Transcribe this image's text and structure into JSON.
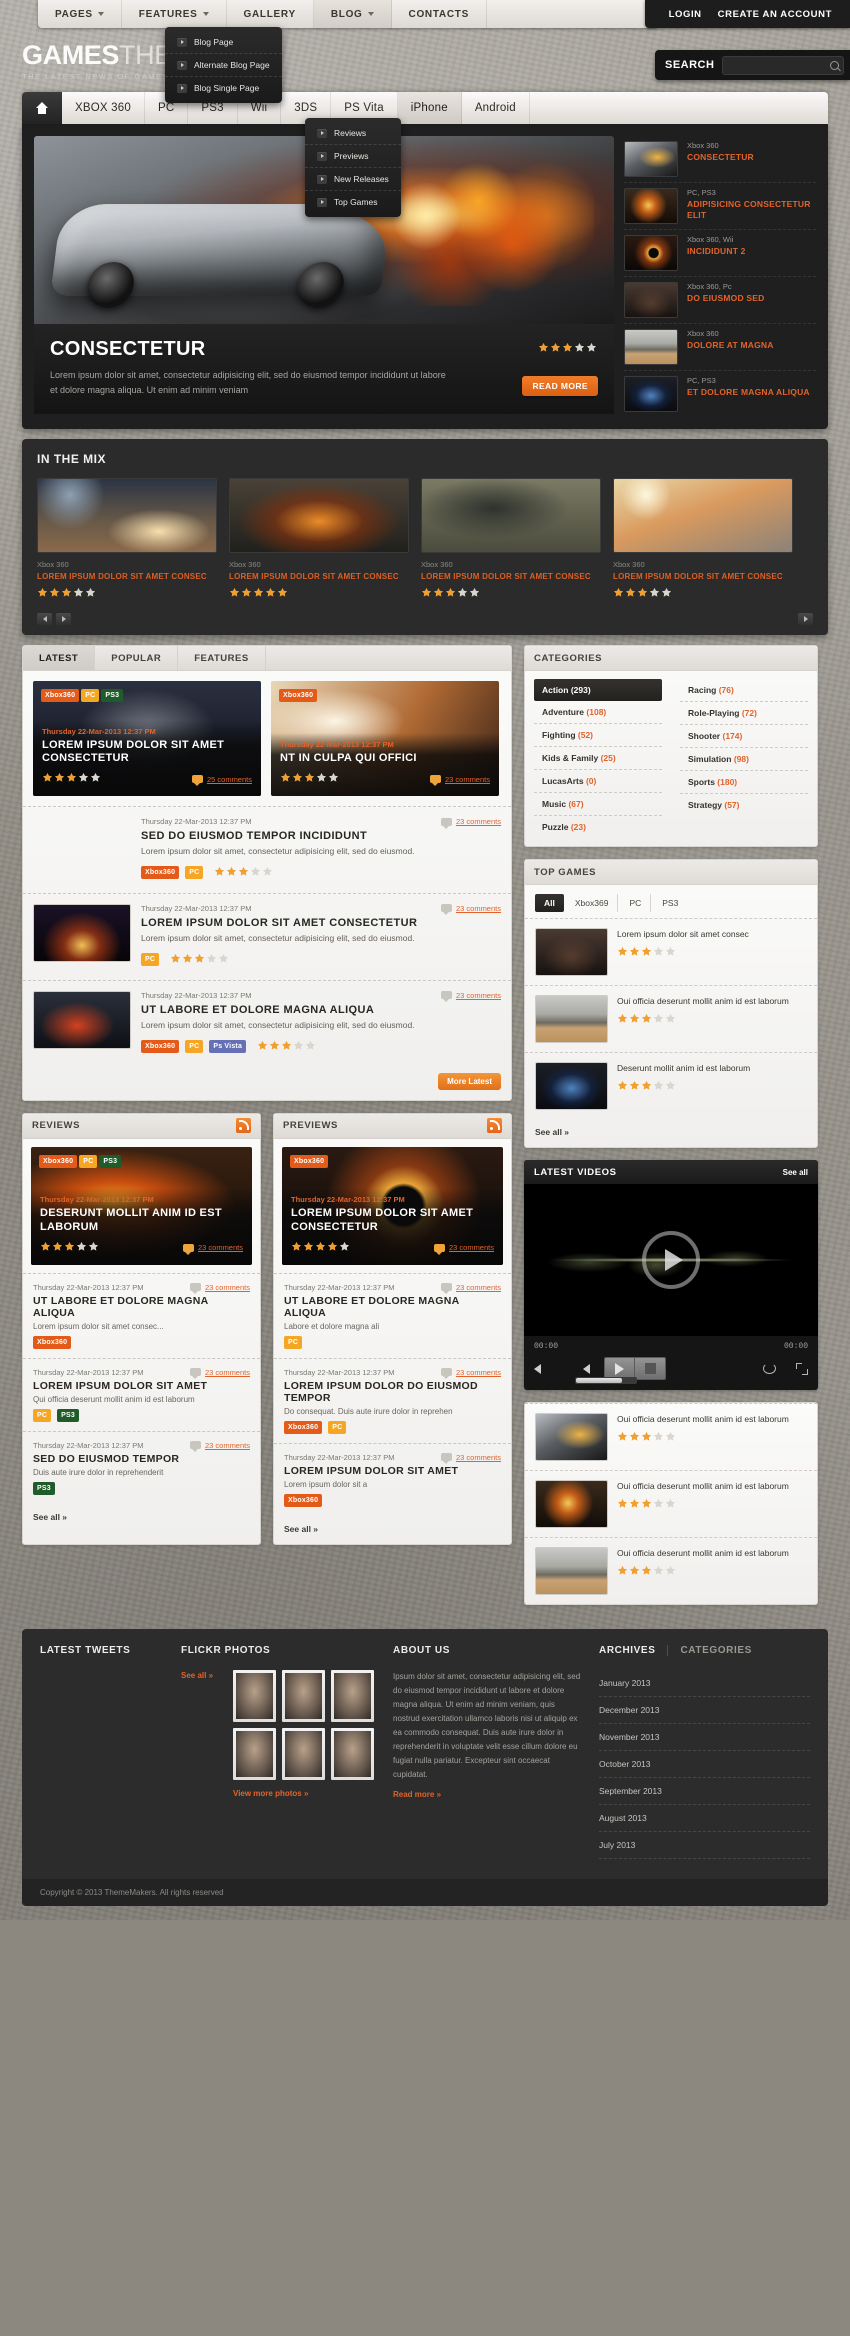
{
  "topnav": {
    "items": [
      {
        "label": "PAGES",
        "caret": true,
        "active": false
      },
      {
        "label": "FEATURES",
        "caret": true,
        "active": false
      },
      {
        "label": "GALLERY",
        "caret": false,
        "active": false
      },
      {
        "label": "BLOG",
        "caret": true,
        "active": true
      },
      {
        "label": "CONTACTS",
        "caret": false,
        "active": false
      }
    ],
    "auth": {
      "login": "LOGIN",
      "create": "CREATE AN ACCOUNT"
    }
  },
  "blog_dropdown": {
    "items": [
      "Blog Page",
      "Alternate Blog Page",
      "Blog Single Page"
    ]
  },
  "platform_dropdown": {
    "items": [
      "Reviews",
      "Previews",
      "New Releases",
      "Top Games"
    ]
  },
  "header": {
    "logo_bold": "GAMES",
    "logo_light": "THEME",
    "tagline": "THE LATEST NEWS OF GAMES",
    "search_label": "SEARCH",
    "search_placeholder": "",
    "search_value": ""
  },
  "platnav": {
    "home_icon": "home-icon",
    "items": [
      {
        "label": "XBOX 360",
        "active": false
      },
      {
        "label": "PC",
        "active": false
      },
      {
        "label": "PS3",
        "active": false
      },
      {
        "label": "Wii",
        "active": false
      },
      {
        "label": "3DS",
        "active": false
      },
      {
        "label": "PS Vita",
        "active": false
      },
      {
        "label": "iPhone",
        "active": true
      },
      {
        "label": "Android",
        "active": false
      }
    ]
  },
  "slider": {
    "title": "CONSECTETUR",
    "excerpt": "Lorem ipsum dolor sit amet, consectetur adipisicing elit, sed do eiusmod tempor incididunt ut labore et dolore magna aliqua. Ut enim ad minim veniam",
    "rating": 3,
    "read_more": "READ MORE",
    "items": [
      {
        "platform": "Xbox 360",
        "title": "CONSECTETUR",
        "thumb": "car-race"
      },
      {
        "platform": "PC, PS3",
        "title": "ADIPISICING CONSECTETUR ELIT",
        "thumb": "explosion"
      },
      {
        "platform": "Xbox 360, Wii",
        "title": "INCIDIDUNT 2",
        "thumb": "eclipse"
      },
      {
        "platform": "Xbox 360, Pc",
        "title": "DO EIUSMOD SED",
        "thumb": "dark-forest"
      },
      {
        "platform": "Xbox 360",
        "title": "DOLORE AT MAGNA",
        "thumb": "tank"
      },
      {
        "platform": "PC, PS3",
        "title": "ET DOLORE MAGNA ALIQUA",
        "thumb": "blue-mech"
      }
    ]
  },
  "mix": {
    "heading": "IN THE MIX",
    "cards": [
      {
        "platform": "Xbox 360",
        "title": "LOREM IPSUM DOLOR SIT AMET CONSEC",
        "rating": 3,
        "art": "planet"
      },
      {
        "platform": "Xbox 360",
        "title": "LOREM IPSUM DOLOR SIT AMET CONSEC",
        "rating": 5,
        "art": "foundry"
      },
      {
        "platform": "Xbox 360",
        "title": "LOREM IPSUM DOLOR SIT AMET CONSEC",
        "rating": 3,
        "art": "mech"
      },
      {
        "platform": "Xbox 360",
        "title": "LOREM IPSUM DOLOR SIT AMET CONSEC",
        "rating": 3,
        "art": "desert"
      }
    ]
  },
  "main_tabs": [
    {
      "label": "LATEST",
      "active": true
    },
    {
      "label": "POPULAR",
      "active": false
    },
    {
      "label": "FEATURES",
      "active": false
    }
  ],
  "hero_posts": [
    {
      "badges": [
        "Xbox360",
        "PC",
        "PS3"
      ],
      "date": "Thursday 22-Mar-2013 12:37 PM",
      "title": "LOREM IPSUM DOLOR SIT AMET CONSECTETUR",
      "rating": 3,
      "comments": "25 comments",
      "art": "warrior"
    },
    {
      "badges": [
        "Xbox360"
      ],
      "date": "Thursday 22-Mar-2013 12:37 PM",
      "title": "NT IN CULPA QUI OFFICI",
      "rating": 3,
      "comments": "23 comments",
      "art": "biker"
    }
  ],
  "posts": [
    {
      "date": "Thursday 22-Mar-2013 12:37 PM",
      "comments": "23 comments",
      "title": "SED DO EIUSMOD TEMPOR INCIDIDUNT",
      "excerpt": "Lorem ipsum dolor sit amet, consectetur adipisicing elit, sed do eiusmod.",
      "badges": [
        "Xbox360",
        "PC"
      ],
      "rating": 3,
      "thumb": null
    },
    {
      "date": "Thursday 22-Mar-2013 12:37 PM",
      "comments": "23 comments",
      "title": "LOREM IPSUM DOLOR SIT AMET CONSECTETUR",
      "excerpt": "Lorem ipsum dolor sit amet, consectetur adipisicing elit, sed do eiusmod.",
      "badges": [
        "PC"
      ],
      "rating": 3,
      "thumb": "nebula"
    },
    {
      "date": "Thursday 22-Mar-2013 12:37 PM",
      "comments": "23 comments",
      "title": "UT LABORE ET DOLORE MAGNA ALIQUA",
      "excerpt": "Lorem ipsum dolor sit amet, consectetur adipisicing elit, sed do eiusmod.",
      "badges": [
        "Xbox360",
        "PC",
        "Ps Vista"
      ],
      "rating": 3,
      "thumb": "redcar"
    }
  ],
  "more_latest": "More Latest",
  "categories": {
    "heading": "CATEGORIES",
    "left": [
      {
        "name": "Action",
        "count": "(293)",
        "active": true
      },
      {
        "name": "Adventure",
        "count": "(108)",
        "active": false
      },
      {
        "name": "Fighting",
        "count": "(52)",
        "active": false
      },
      {
        "name": "Kids & Family",
        "count": "(25)",
        "active": false
      },
      {
        "name": "LucasArts",
        "count": "(0)",
        "active": false
      },
      {
        "name": "Music",
        "count": "(67)",
        "active": false
      },
      {
        "name": "Puzzle",
        "count": "(23)",
        "active": false
      }
    ],
    "right": [
      {
        "name": "Racing",
        "count": "(76)",
        "active": false
      },
      {
        "name": "Role-Playing",
        "count": "(72)",
        "active": false
      },
      {
        "name": "Shooter",
        "count": "(174)",
        "active": false
      },
      {
        "name": "Simulation",
        "count": "(98)",
        "active": false
      },
      {
        "name": "Sports",
        "count": "(180)",
        "active": false
      },
      {
        "name": "Strategy",
        "count": "(57)",
        "active": false
      }
    ]
  },
  "top_games": {
    "heading": "TOP GAMES",
    "filters": [
      {
        "label": "All",
        "active": true
      },
      {
        "label": "Xbox369",
        "active": false
      },
      {
        "label": "PC",
        "active": false
      },
      {
        "label": "PS3",
        "active": false
      }
    ],
    "items": [
      {
        "title": "Lorem ipsum dolor sit amet consec",
        "rating": 3,
        "art": "dark-forest"
      },
      {
        "title": "Oui officia deserunt mollit anim id est laborum",
        "rating": 3,
        "art": "tank"
      },
      {
        "title": "Deserunt mollit anim id est laborum",
        "rating": 3,
        "art": "blue-mech"
      }
    ],
    "see_all": "See all »"
  },
  "videos": {
    "heading": "LATEST VIDEOS",
    "see_all": "See all",
    "time_left": "00:00",
    "time_right": "00:00",
    "items": [
      {
        "title": "Oui officia deserunt mollit anim id est laborum",
        "rating": 3,
        "art": "car-race"
      },
      {
        "title": "Oui officia deserunt mollit anim id est laborum",
        "rating": 3,
        "art": "explosion"
      },
      {
        "title": "Oui officia deserunt mollit anim id est laborum",
        "rating": 3,
        "art": "tank"
      }
    ]
  },
  "reviews": {
    "heading": "REVIEWS",
    "hero": {
      "badges": [
        "Xbox360",
        "PC",
        "PS3"
      ],
      "date": "Thursday 22-Mar-2013 12:37 PM",
      "title": "DESERUNT MOLLIT ANIM ID EST LABORUM",
      "rating": 3,
      "comments": "23 comments",
      "art": "firefight"
    },
    "rows": [
      {
        "date": "Thursday 22-Mar-2013 12:37 PM",
        "comments": "23 comments",
        "title": "UT LABORE ET DOLORE MAGNA ALIQUA",
        "excerpt": "Lorem ipsum dolor sit amet consec...",
        "badges": [
          "Xbox360"
        ]
      },
      {
        "date": "Thursday 22-Mar-2013 12:37 PM",
        "comments": "23 comments",
        "title": "LOREM IPSUM DOLOR SIT AMET",
        "excerpt": "Qui officia deserunt mollit anim id est laborum",
        "badges": [
          "PC",
          "PS3"
        ]
      },
      {
        "date": "Thursday 22-Mar-2013 12:37 PM",
        "comments": "23 comments",
        "title": "SED DO EIUSMOD TEMPOR",
        "excerpt": "Duis aute irure dolor in reprehenderit",
        "badges": [
          "PS3"
        ]
      }
    ],
    "see_all": "See all »"
  },
  "previews": {
    "heading": "PREVIEWS",
    "hero": {
      "badges": [
        "Xbox360"
      ],
      "date": "Thursday 22-Mar-2013 12:37 PM",
      "title": "LOREM IPSUM DOLOR SIT AMET CONSECTETUR",
      "rating": 4,
      "comments": "23 comments",
      "art": "eclipse"
    },
    "rows": [
      {
        "date": "Thursday 22-Mar-2013 12:37 PM",
        "comments": "23 comments",
        "title": "UT LABORE ET DOLORE MAGNA ALIQUA",
        "excerpt": "Labore et dolore magna ali",
        "badges": [
          "PC"
        ]
      },
      {
        "date": "Thursday 22-Mar-2013 12:37 PM",
        "comments": "23 comments",
        "title": "LOREM IPSUM DOLOR DO EIUSMOD TEMPOR",
        "excerpt": "Do consequat. Duis aute irure dolor in reprehen",
        "badges": [
          "Xbox360",
          "PC"
        ]
      },
      {
        "date": "Thursday 22-Mar-2013 12:37 PM",
        "comments": "23 comments",
        "title": "LOREM IPSUM DOLOR SIT AMET",
        "excerpt": "Lorem ipsum dolor sit a",
        "badges": [
          "Xbox360"
        ]
      }
    ],
    "see_all": "See all »"
  },
  "footer": {
    "tweets_heading": "LATEST TWEETS",
    "flickr_heading": "FLICKR PHOTOS",
    "flickr_see_all": "See all »",
    "flickr_view_more": "View more photos »",
    "about_heading": "ABOUT US",
    "about_text": "Ipsum dolor sit amet, consectetur adipisicing elit, sed do eiusmod tempor incididunt ut labore et dolore magna aliqua. Ut enim ad minim veniam, quis nostrud exercitation ullamco laboris nisi ut aliquip ex ea commodo consequat. Duis aute irure dolor in reprehenderit in voluptate velit esse cillum dolore eu fugiat nulla pariatur. Excepteur sint occaecat cupidatat.",
    "about_read_more": "Read more »",
    "archives_heading": "ARCHIVES",
    "categories_heading": "CATEGORIES",
    "archives": [
      "January 2013",
      "December 2013",
      "November 2013",
      "October 2013",
      "September 2013",
      "August 2013",
      "July 2013"
    ],
    "copyright": "Copyright © 2013  ThemeMakers. All rights reserved"
  },
  "colors": {
    "accent": "#e2632a",
    "dark": "#1f1f1f",
    "xbox_badge": "#e35a19",
    "pc_badge": "#f5a623",
    "ps3_badge": "#1f5c2a",
    "psvita_badge": "#6670b4"
  }
}
